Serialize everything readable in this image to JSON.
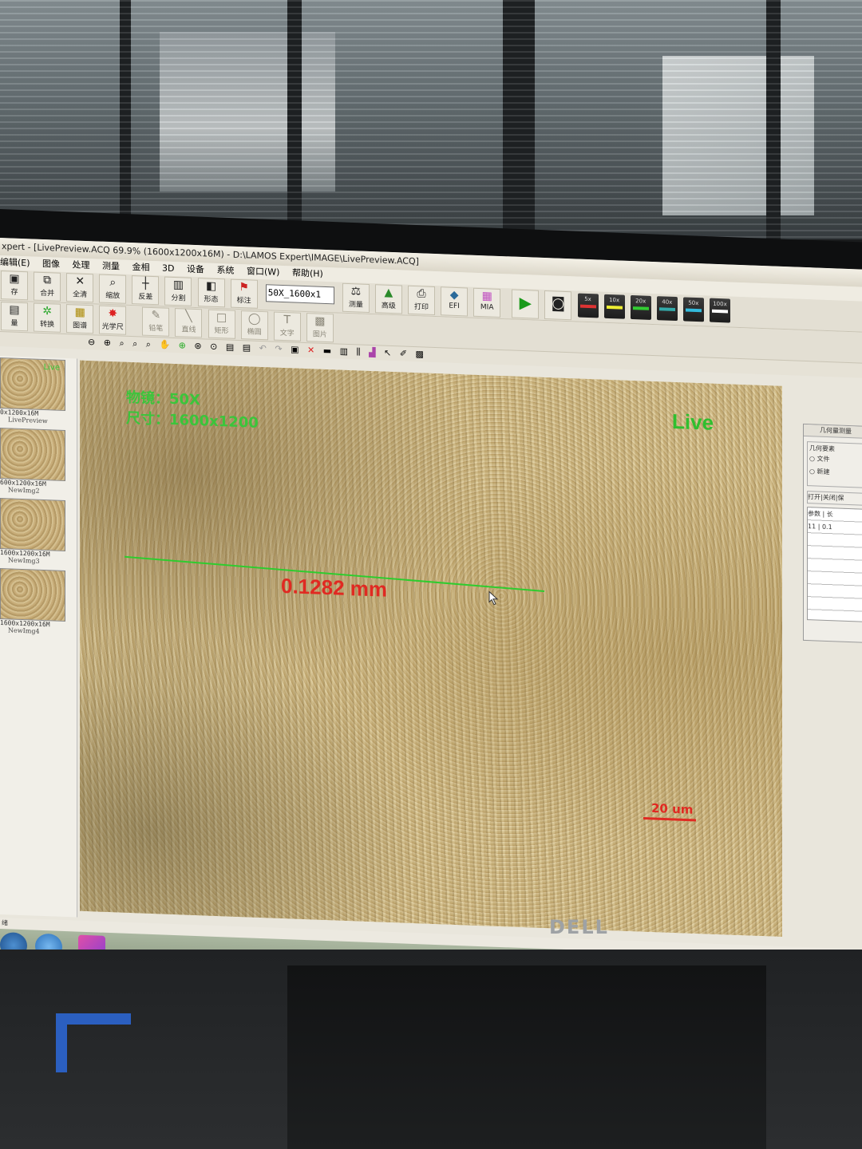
{
  "window": {
    "title": "xpert - [LivePreview.ACQ 69.9% (1600x1200x16M) - D:\\LAMOS Expert\\IMAGE\\LivePreview.ACQ]"
  },
  "menu": [
    "编辑(E)",
    "图像",
    "处理",
    "测量",
    "金相",
    "3D",
    "设备",
    "系统",
    "窗口(W)",
    "帮助(H)"
  ],
  "toolbar1": {
    "buttons": [
      {
        "label": "存",
        "icon": "save-icon"
      },
      {
        "label": "合并",
        "icon": "merge-icon"
      },
      {
        "label": "全清",
        "icon": "clear-all-icon"
      },
      {
        "label": "缩放",
        "icon": "zoom-icon"
      },
      {
        "label": "反差",
        "icon": "contrast-icon"
      },
      {
        "label": "分割",
        "icon": "split-icon"
      },
      {
        "label": "形态",
        "icon": "morphology-icon"
      },
      {
        "label": "标注",
        "icon": "flag-icon"
      }
    ],
    "objective_select": "50X_1600x1",
    "buttons2": [
      {
        "label": "测量",
        "icon": "measure-icon"
      },
      {
        "label": "高级",
        "icon": "advanced-icon"
      },
      {
        "label": "打印",
        "icon": "print-icon"
      },
      {
        "label": "EFI",
        "icon": "efi-icon"
      },
      {
        "label": "MIA",
        "icon": "mia-icon"
      }
    ],
    "objectives": [
      "5x",
      "10x",
      "20x",
      "40x",
      "50x",
      "100x"
    ]
  },
  "toolbar2": {
    "buttons": [
      {
        "label": "量",
        "icon": "measure-small-icon",
        "dim": false
      },
      {
        "label": "转换",
        "icon": "convert-icon",
        "dim": false
      },
      {
        "label": "图谱",
        "icon": "atlas-icon",
        "dim": false
      },
      {
        "label": "光学尺",
        "icon": "optical-ruler-icon",
        "dim": false
      },
      {
        "label": "铅笔",
        "icon": "pencil-icon",
        "dim": true
      },
      {
        "label": "直线",
        "icon": "line-icon",
        "dim": true
      },
      {
        "label": "矩形",
        "icon": "rectangle-icon",
        "dim": true
      },
      {
        "label": "椭圆",
        "icon": "ellipse-icon",
        "dim": true
      },
      {
        "label": "文字",
        "icon": "text-icon",
        "dim": true
      },
      {
        "label": "图片",
        "icon": "image-icon",
        "dim": true
      }
    ]
  },
  "thumbnails": [
    {
      "size": "0x1200x16M",
      "name": "LivePreview",
      "live": "Live"
    },
    {
      "size": "600x1200x16M",
      "name": "NewImg2",
      "live": ""
    },
    {
      "size": "1600x1200x16M",
      "name": "NewImg3",
      "live": ""
    },
    {
      "size": "1600x1200x16M",
      "name": "NewImg4",
      "live": ""
    }
  ],
  "viewer": {
    "objective_text": "物镜：50X",
    "size_text": "尺寸：1600x1200",
    "live_text": "Live",
    "measurement_text": "0.1282 mm",
    "scale_bar_text": "20 um",
    "colors": {
      "overlay_green": "#3bc53b",
      "measure_line": "#2ecc2e",
      "measure_text": "#e02a22"
    }
  },
  "right_panel": {
    "title": "几何量测量",
    "group_title": "几何要素",
    "options": [
      "文件",
      "新建"
    ],
    "buttons": [
      "打开",
      "关闭",
      "保"
    ],
    "columns": [
      "参数",
      "长"
    ],
    "rows": [
      [
        "11",
        "0.1"
      ]
    ]
  },
  "status": {
    "text": "绪"
  },
  "taskbar": {
    "apps": [
      "start-icon",
      "ie-icon",
      "app-icon"
    ]
  }
}
